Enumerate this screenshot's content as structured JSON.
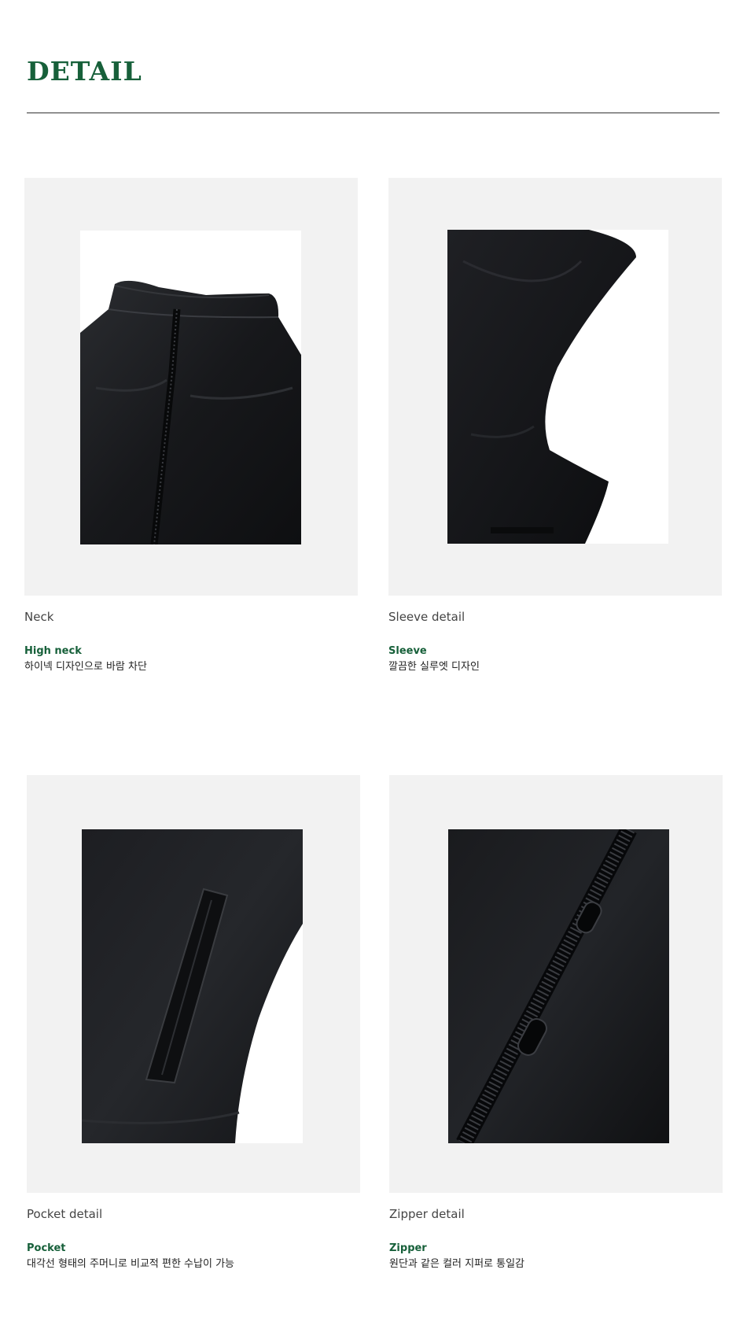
{
  "section": {
    "title": "DETAIL"
  },
  "details": [
    {
      "label": "Neck",
      "highlight": "High neck",
      "description": "하이넥 디자인으로 바람 차단",
      "image": "black-leather-vest-neck-photo"
    },
    {
      "label": "Sleeve detail",
      "highlight": "Sleeve",
      "description": "깔끔한 실루엣 디자인",
      "image": "black-leather-vest-armhole-photo"
    },
    {
      "label": "Pocket detail",
      "highlight": "Pocket",
      "description": "대각선 형태의 주머니로 비교적 편한 수납이 가능",
      "image": "black-leather-vest-pocket-photo"
    },
    {
      "label": "Zipper detail",
      "highlight": "Zipper",
      "description": "원단과 같은 컬러 지퍼로 통일감",
      "image": "black-leather-vest-zipper-photo"
    }
  ],
  "colors": {
    "accent": "#17603a",
    "frame": "#f2f2f2",
    "rule": "#333333",
    "garment": "#151618"
  }
}
